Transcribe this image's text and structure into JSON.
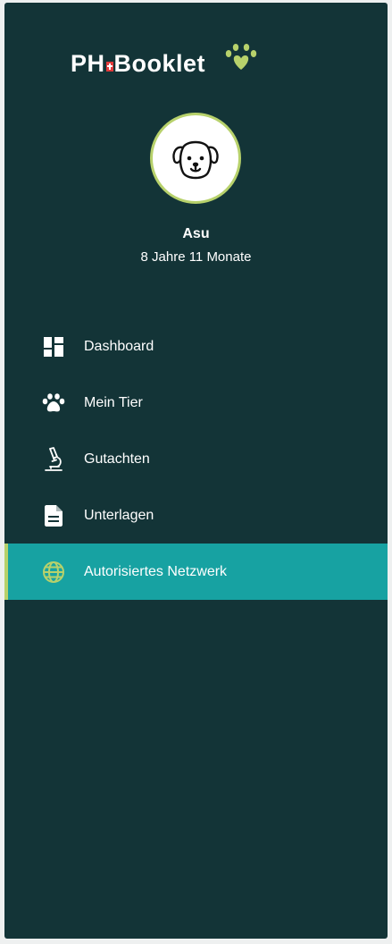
{
  "brand": {
    "logo_ph": "PH",
    "logo_rest": "Booklet"
  },
  "pet": {
    "name": "Asu",
    "age": "8 Jahre 11 Monate"
  },
  "nav": {
    "items": [
      {
        "label": "Dashboard",
        "icon": "dashboard-icon"
      },
      {
        "label": "Mein Tier",
        "icon": "paw-icon"
      },
      {
        "label": "Gutachten",
        "icon": "microscope-icon"
      },
      {
        "label": "Unterlagen",
        "icon": "document-icon"
      },
      {
        "label": "Autorisiertes Netzwerk",
        "icon": "globe-icon",
        "active": true
      }
    ]
  },
  "colors": {
    "sidebar_bg": "#133437",
    "active_bg": "#17a2a2",
    "accent": "#b7d16b"
  }
}
